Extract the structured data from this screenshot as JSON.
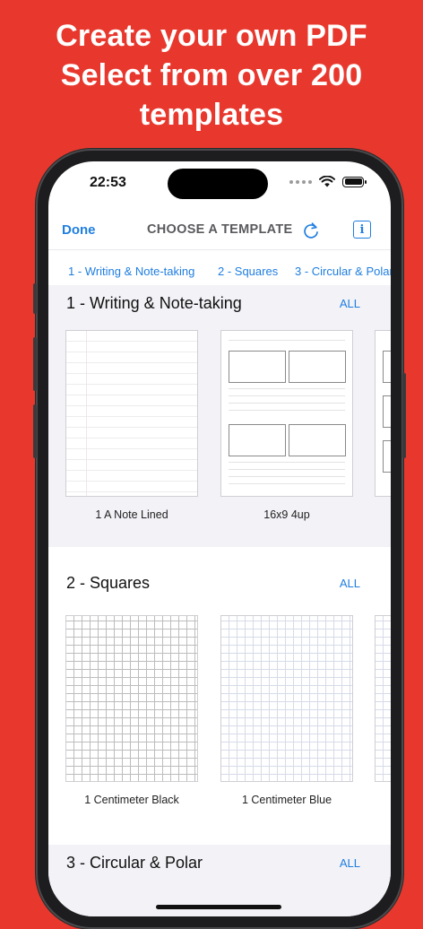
{
  "headline": {
    "line1": "Create your own PDF",
    "line2": "Select from over 200",
    "line3": "templates"
  },
  "status_bar": {
    "time": "22:53"
  },
  "navbar": {
    "done_label": "Done",
    "title": "CHOOSE A TEMPLATE",
    "info_glyph": "i"
  },
  "tabs": [
    {
      "label": "1 - Writing & Note-taking"
    },
    {
      "label": "2 - Squares"
    },
    {
      "label": "3 - Circular & Polar"
    }
  ],
  "sections": [
    {
      "title": "1 - Writing & Note-taking",
      "all_label": "ALL",
      "templates": [
        {
          "name": "1 A Note Lined"
        },
        {
          "name": "16x9 4up"
        }
      ]
    },
    {
      "title": "2 - Squares",
      "all_label": "ALL",
      "templates": [
        {
          "name": "1 Centimeter Black"
        },
        {
          "name": "1 Centimeter Blue"
        }
      ]
    },
    {
      "title": "3 - Circular & Polar",
      "all_label": "ALL"
    }
  ],
  "colors": {
    "background": "#E8382E",
    "accent": "#1F7EE0",
    "section_bg": "#F2F2F7"
  }
}
